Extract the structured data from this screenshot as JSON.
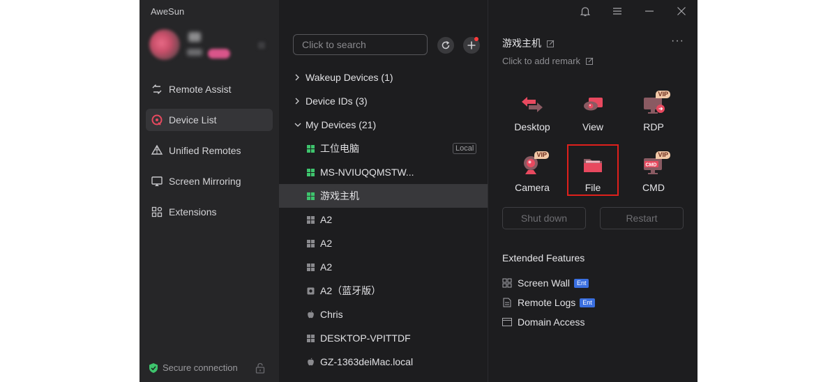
{
  "app": {
    "title": "AweSun"
  },
  "sidebar": {
    "items": [
      {
        "label": "Remote Assist",
        "icon": "remote-assist-icon"
      },
      {
        "label": "Device List",
        "icon": "device-list-icon",
        "active": true
      },
      {
        "label": "Unified Remotes",
        "icon": "unified-remotes-icon"
      },
      {
        "label": "Screen Mirroring",
        "icon": "screen-mirroring-icon"
      },
      {
        "label": "Extensions",
        "icon": "extensions-icon"
      }
    ],
    "secure": "Secure connection"
  },
  "search": {
    "placeholder": "Click to search"
  },
  "groups": [
    {
      "label": "Wakeup Devices (1)",
      "expanded": false
    },
    {
      "label": "Device IDs (3)",
      "expanded": false
    },
    {
      "label": "My Devices (21)",
      "expanded": true
    }
  ],
  "devices": [
    {
      "name": "工位电脑",
      "os": "windows",
      "online": true,
      "tag": "Local"
    },
    {
      "name": "MS-NVIUQQMSTW...",
      "os": "windows",
      "online": true
    },
    {
      "name": "游戏主机",
      "os": "windows",
      "online": true,
      "selected": true
    },
    {
      "name": "A2",
      "os": "windows",
      "online": false
    },
    {
      "name": "A2",
      "os": "windows",
      "online": false
    },
    {
      "name": "A2",
      "os": "windows",
      "online": false
    },
    {
      "name": "A2（蓝牙版）",
      "os": "device",
      "online": false
    },
    {
      "name": "Chris",
      "os": "apple",
      "online": false
    },
    {
      "name": "DESKTOP-VPITTDF",
      "os": "windows",
      "online": false
    },
    {
      "name": "GZ-1363deiMac.local",
      "os": "apple",
      "online": false
    }
  ],
  "detail": {
    "device_name": "游戏主机",
    "remark": "Click to add remark",
    "features": [
      {
        "label": "Desktop",
        "vip": false
      },
      {
        "label": "View",
        "vip": false
      },
      {
        "label": "RDP",
        "vip": true
      },
      {
        "label": "Camera",
        "vip": true
      },
      {
        "label": "File",
        "vip": false
      },
      {
        "label": "CMD",
        "vip": true,
        "icon_text": "CMD"
      }
    ],
    "vip_label": "VIP",
    "shutdown": "Shut down",
    "restart": "Restart",
    "extended_title": "Extended Features",
    "extended": [
      {
        "label": "Screen Wall",
        "badge": "Ent"
      },
      {
        "label": "Remote Logs",
        "badge": "Ent"
      },
      {
        "label": "Domain Access",
        "badge": ""
      }
    ]
  },
  "colors": {
    "accent": "#e8495f",
    "online": "#3ec46d",
    "offline": "#8a8a8e",
    "highlight": "#e0201c",
    "ent": "#3a6fe0"
  }
}
